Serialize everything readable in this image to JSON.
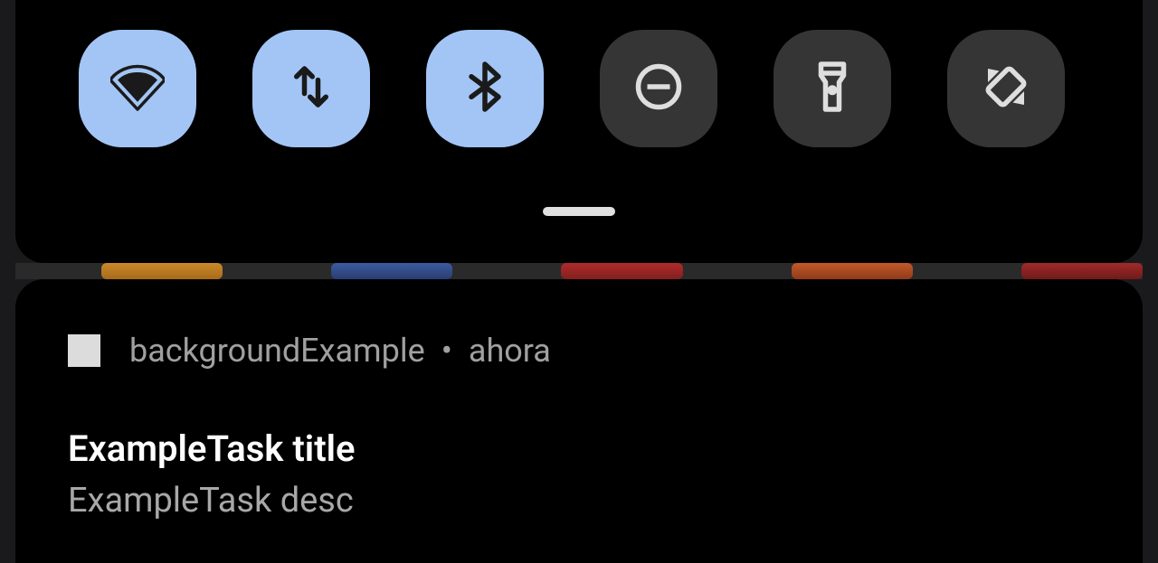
{
  "quick_settings": {
    "tiles": [
      {
        "name": "wifi",
        "active": true
      },
      {
        "name": "mobile-data",
        "active": true
      },
      {
        "name": "bluetooth",
        "active": true
      },
      {
        "name": "do-not-disturb",
        "active": false
      },
      {
        "name": "flashlight",
        "active": false
      },
      {
        "name": "auto-rotate",
        "active": false
      }
    ]
  },
  "notification": {
    "app_name": "backgroundExample",
    "separator": "•",
    "timestamp": "ahora",
    "title": "ExampleTask title",
    "description": "ExampleTask desc"
  }
}
